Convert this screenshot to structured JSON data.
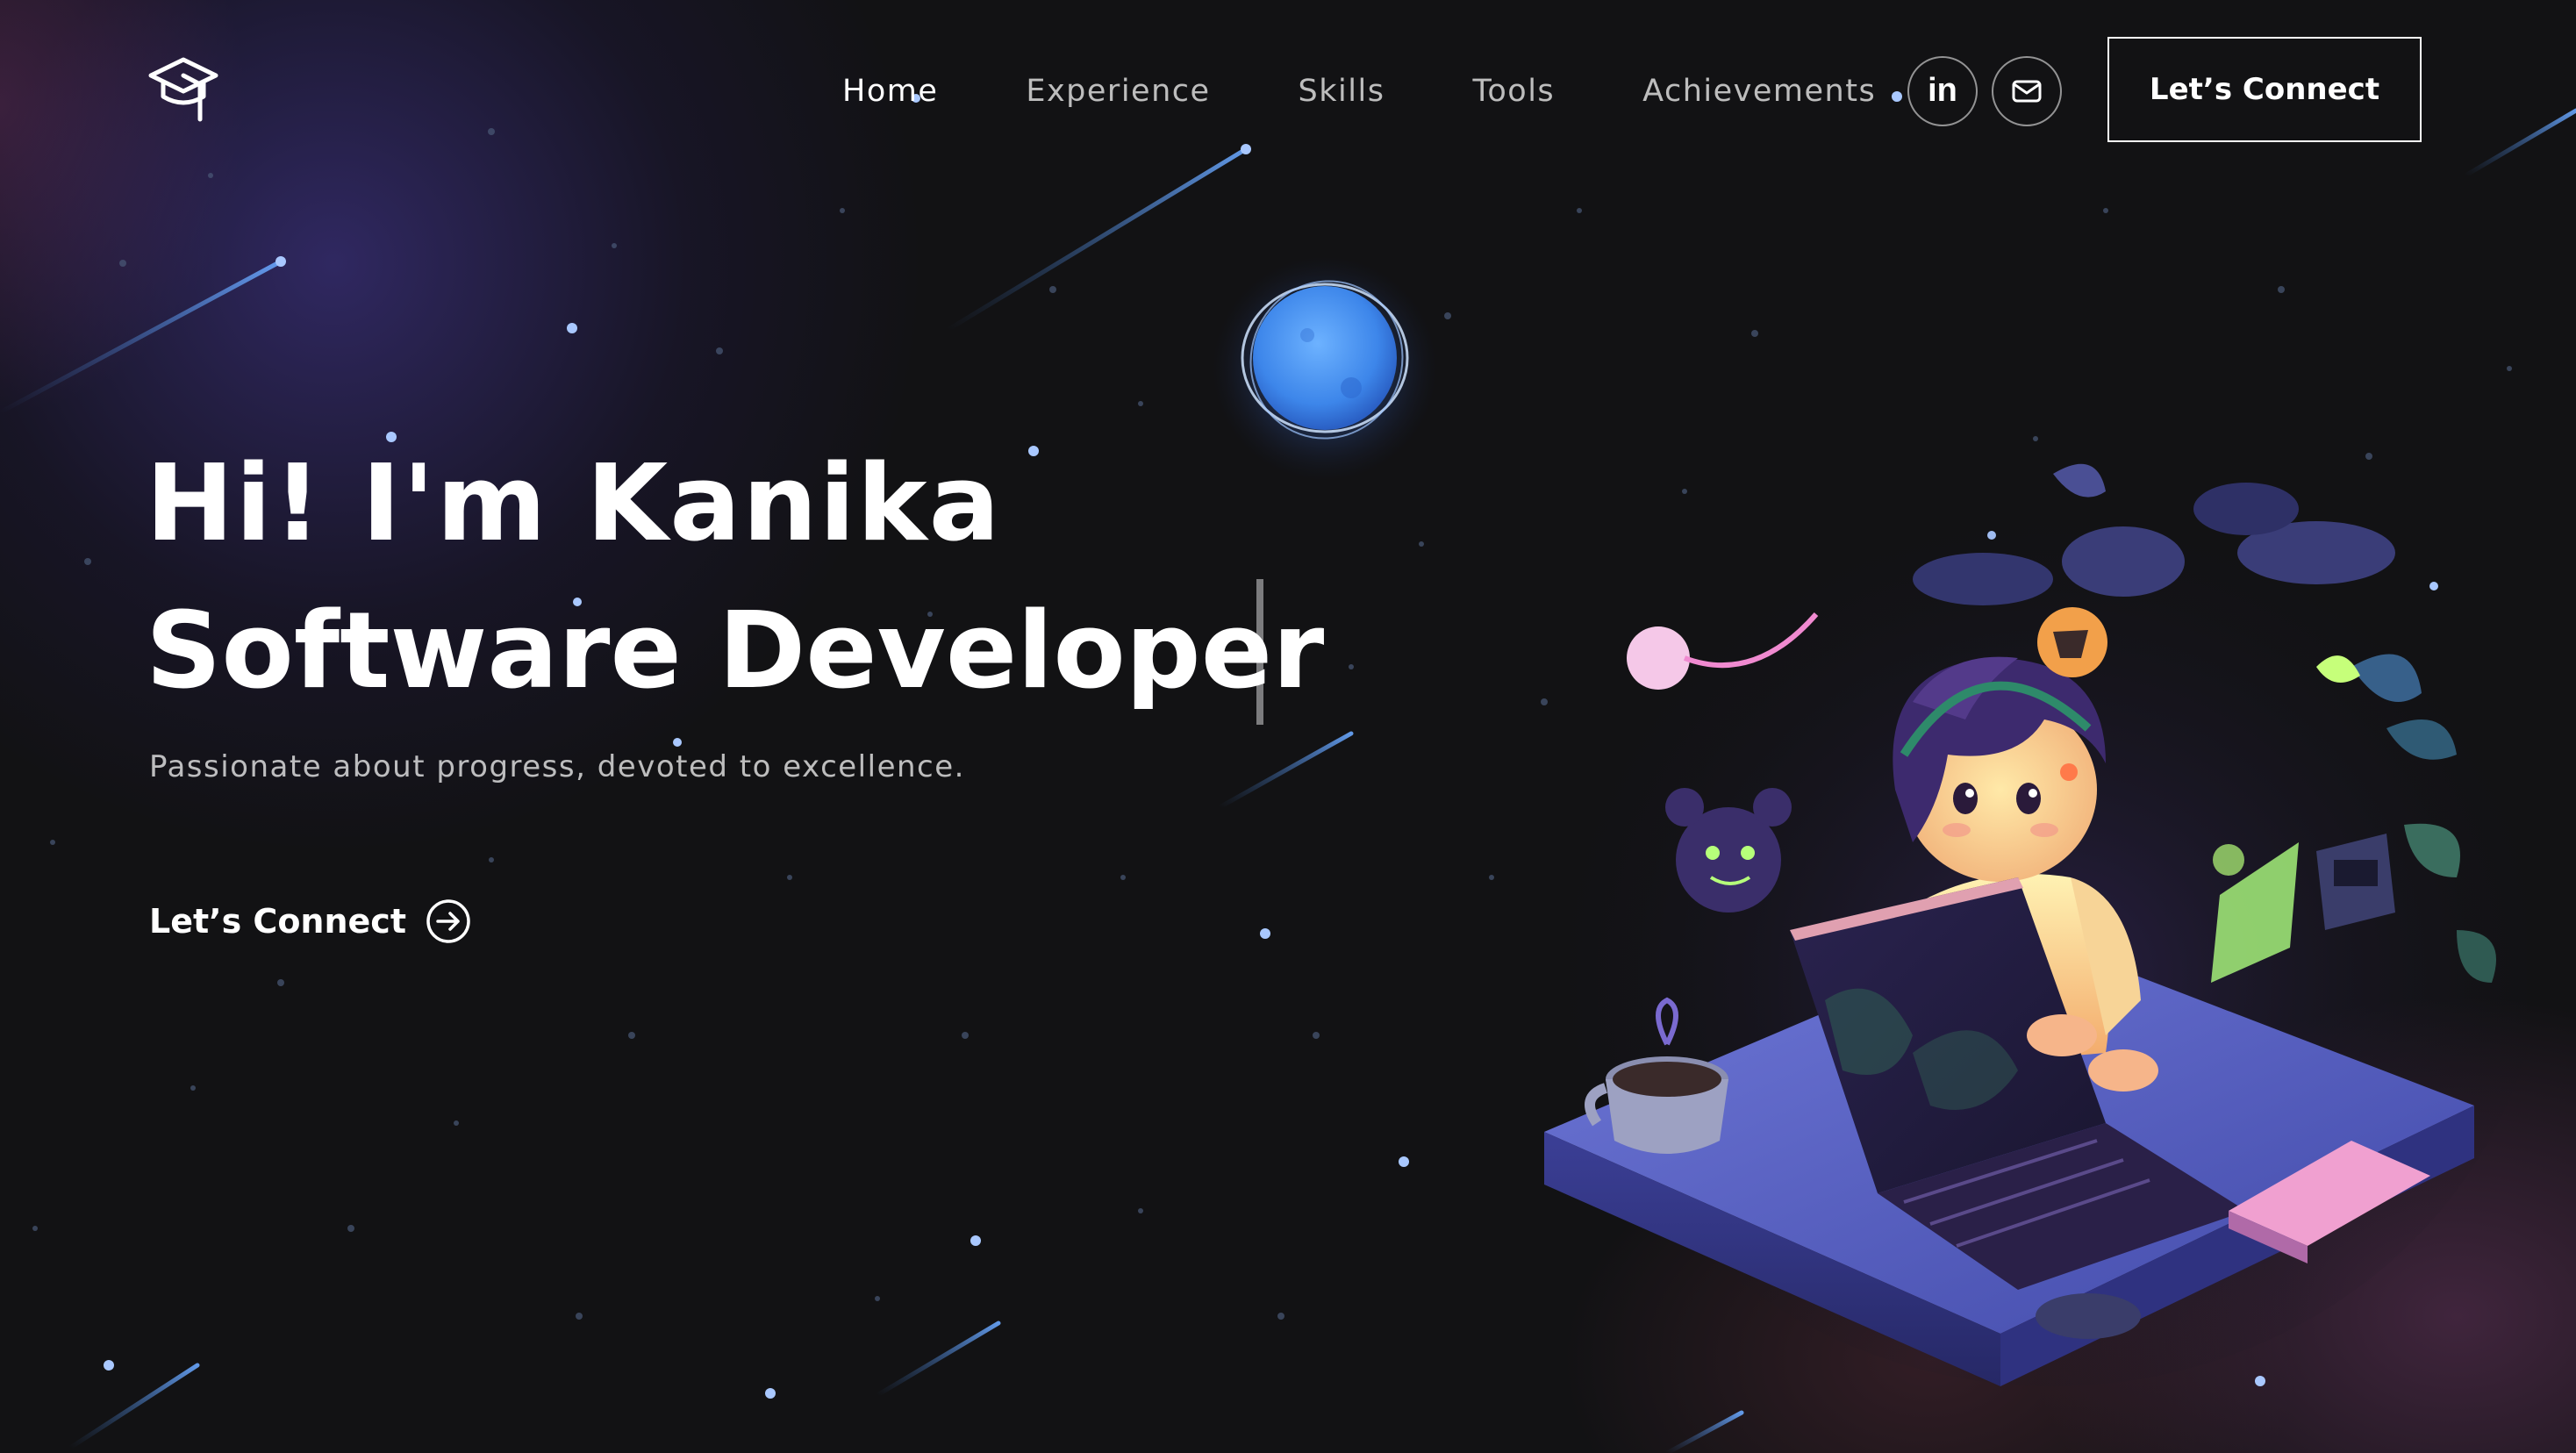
{
  "nav": {
    "logo_icon": "graduation-cap-icon",
    "links": [
      {
        "label": "Home"
      },
      {
        "label": "Experience"
      },
      {
        "label": "Skills"
      },
      {
        "label": "Tools"
      },
      {
        "label": "Achievements"
      }
    ],
    "active_link": "Home",
    "social": {
      "linkedin_label": "in",
      "linkedin_icon": "linkedin-icon",
      "email_icon": "mail-icon"
    },
    "connect_button": "Let’s Connect"
  },
  "hero": {
    "greeting": "Hi! I'm Kanika",
    "role": "Software Developer",
    "tagline": "Passionate about progress, devoted to excellence.",
    "cta_label": "Let’s Connect",
    "cta_icon": "arrow-right-circle-icon"
  },
  "theme": {
    "background": "#121214",
    "accent_blue": "#4d8ff0",
    "text": "#ffffff"
  }
}
